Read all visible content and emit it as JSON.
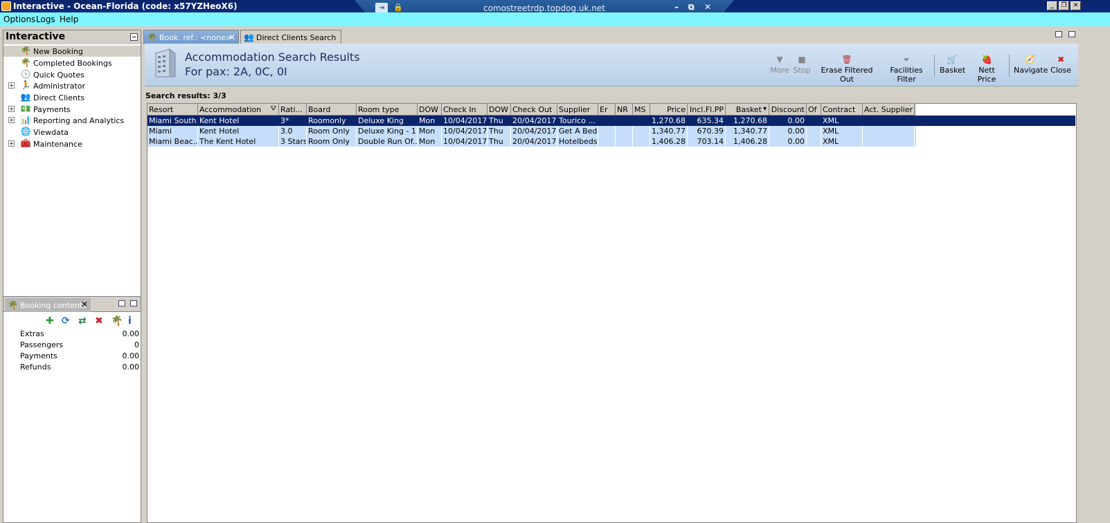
{
  "window": {
    "title": "Interactive - Ocean-Florida (code: x57YZHeoX6)",
    "min": "_",
    "restore": "❐",
    "close": "✕"
  },
  "rdp": {
    "host": "comostreetrdp.topdog.uk.net",
    "pin": "⇥",
    "lock": "🔒",
    "min": "–",
    "restore": "⧉",
    "close": "✕"
  },
  "menu": [
    "Options",
    "Logs",
    "Help"
  ],
  "nav": {
    "title": "Interactive",
    "items": [
      {
        "label": "New Booking",
        "icon": "palm-tree-icon",
        "glyph": "🌴",
        "expandable": false
      },
      {
        "label": "Completed Bookings",
        "icon": "palm-tree-icon",
        "glyph": "🌴",
        "expandable": false
      },
      {
        "label": "Quick Quotes",
        "icon": "clock-icon",
        "glyph": "🕓",
        "expandable": false
      },
      {
        "label": "Administrator",
        "icon": "running-man-icon",
        "glyph": "🏃",
        "expandable": true
      },
      {
        "label": "Direct Clients",
        "icon": "clients-icon",
        "glyph": "👥",
        "expandable": false
      },
      {
        "label": "Payments",
        "icon": "payments-icon",
        "glyph": "💵",
        "expandable": true
      },
      {
        "label": "Reporting and Analytics",
        "icon": "report-icon",
        "glyph": "📊",
        "expandable": true
      },
      {
        "label": "Viewdata",
        "icon": "globe-icon",
        "glyph": "🌐",
        "expandable": false
      },
      {
        "label": "Maintenance",
        "icon": "maintenance-icon",
        "glyph": "🧰",
        "expandable": true
      }
    ]
  },
  "booking": {
    "tab_label": "Booking contents",
    "toolbar": [
      {
        "name": "add-icon",
        "glyph": "✚",
        "color": "#2a9a2a"
      },
      {
        "name": "refresh-icon",
        "glyph": "⟳",
        "color": "#2070c0"
      },
      {
        "name": "transfer-icon",
        "glyph": "⇄",
        "color": "#208040"
      },
      {
        "name": "delete-icon",
        "glyph": "✖",
        "color": "#d02020"
      },
      {
        "name": "palm-tree-icon",
        "glyph": "🌴",
        "color": "#2a9a2a"
      },
      {
        "name": "info-icon",
        "glyph": "i",
        "color": "#2050b0"
      }
    ],
    "rows": [
      {
        "label": "Extras",
        "value": "0.00"
      },
      {
        "label": "Passengers",
        "value": "0"
      },
      {
        "label": "Payments",
        "value": "0.00"
      },
      {
        "label": "Refunds",
        "value": "0.00"
      }
    ]
  },
  "tabs": [
    {
      "label": "Book. ref.: <none>",
      "active": true
    },
    {
      "label": "Direct Clients Search",
      "active": false
    }
  ],
  "results": {
    "title": "Accommodation Search Results",
    "subtitle": "For pax: 2A, 0C, 0I",
    "count": "Search results: 3/3",
    "toolbar": [
      {
        "label": "More",
        "disabled": true,
        "glyph": "▼"
      },
      {
        "label": "Stop",
        "disabled": true,
        "glyph": "■"
      },
      {
        "label": "Erase Filtered Out",
        "disabled": false,
        "glyph": "🗑"
      },
      {
        "label": "Facilities Filter",
        "disabled": false,
        "glyph": "⏷"
      },
      {
        "label": "Basket",
        "disabled": false,
        "glyph": "🛒"
      },
      {
        "label": "Nett Price",
        "disabled": false,
        "glyph": "🍓"
      },
      {
        "label": "Navigate",
        "disabled": false,
        "glyph": "🧭"
      },
      {
        "label": "Close",
        "disabled": false,
        "glyph": "✖"
      }
    ]
  },
  "grid": {
    "columns": [
      "Resort",
      "Accommodation",
      "Rati...",
      "Board",
      "Room type",
      "DOW",
      "Check In",
      "DOW",
      "Check Out",
      "Supplier",
      "Er",
      "NR",
      "MS",
      "Price",
      "Incl.Fl.PP",
      "Basket",
      "Discount",
      "Of",
      "Contract",
      "Act. Supplier"
    ],
    "rows": [
      [
        "Miami South...",
        "Kent Hotel",
        "3*",
        "Roomonly",
        "Deluxe King",
        "Mon",
        "10/04/2017",
        "Thu",
        "20/04/2017",
        "Tourico ...",
        "",
        "",
        "",
        "1,270.68",
        "635.34",
        "1,270.68",
        "0.00",
        "",
        "XML",
        ""
      ],
      [
        "Miami",
        "Kent Hotel",
        "3.0",
        "Room Only",
        "Deluxe King - 1...",
        "Mon",
        "10/04/2017",
        "Thu",
        "20/04/2017",
        "Get A Bed",
        "",
        "",
        "",
        "1,340.77",
        "670.39",
        "1,340.77",
        "0.00",
        "",
        "XML",
        ""
      ],
      [
        "Miami Beac...",
        "The Kent Hotel",
        "3 Stars",
        "Room Only",
        "Double Run Of...",
        "Mon",
        "10/04/2017",
        "Thu",
        "20/04/2017",
        "Hotelbeds",
        "",
        "",
        "",
        "1,406.28",
        "703.14",
        "1,406.28",
        "0.00",
        "",
        "XML",
        ""
      ]
    ]
  }
}
